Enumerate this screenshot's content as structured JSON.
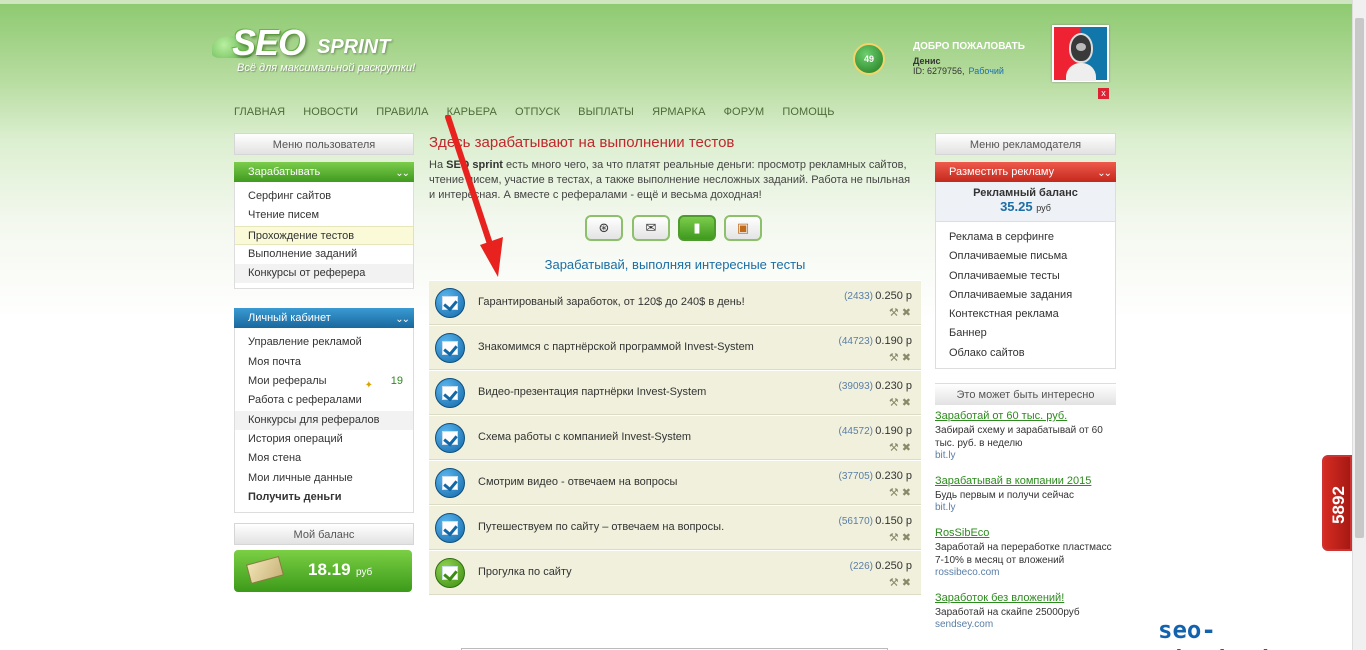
{
  "header": {
    "logo_main": "SEO",
    "logo_sub": "SPRINT",
    "tagline": "Всё для максимальной раскрутки!",
    "level": "49",
    "welcome": "ДОБРО ПОЖАЛОВАТЬ",
    "user_name": "Денис",
    "user_id": "ID: 6279756,",
    "user_status": "Рабочий",
    "close": "x"
  },
  "nav": [
    "ГЛАВНАЯ",
    "НОВОСТИ",
    "ПРАВИЛА",
    "КАРЬЕРА",
    "ОТПУСК",
    "ВЫПЛАТЫ",
    "ЯРМАРКА",
    "ФОРУМ",
    "ПОМОЩЬ"
  ],
  "left": {
    "user_menu_header": "Меню пользователя",
    "earn_tab": "Зарабатывать",
    "earn_items": [
      "Серфинг сайтов",
      "Чтение писем",
      "Прохождение тестов",
      "Выполнение заданий",
      "Конкурсы от реферера"
    ],
    "cabinet_tab": "Личный кабинет",
    "cabinet_items": [
      "Управление рекламой",
      "Моя почта",
      "Мои рефералы",
      "Работа с рефералами",
      "Конкурсы для рефералов",
      "История операций",
      "Моя стена",
      "Мои личные данные",
      "Получить деньги"
    ],
    "referrals_count": "19",
    "balance_header": "Мой баланс",
    "balance_value": "18.19",
    "balance_currency": "руб"
  },
  "center": {
    "title": "Здесь зарабатывают на выполнении тестов",
    "intro_prefix": "На",
    "intro_brand": "SEO sprint",
    "intro_text": "есть много чего, за что платят реальные деньги: просмотр рекламных сайтов, чтение писем, участие в тестах, а также выполнение несложных заданий. Работа не пыльная и интересная. А вместе с рефералами - ещё и весьма доходная!",
    "subtitle": "Зарабатывай, выполняя интересные тесты",
    "tests": [
      {
        "title": "Гарантированый заработок, от 120$ до 240$ в день!",
        "count": "(2433)",
        "price": "0.250 р"
      },
      {
        "title": "Знакомимся с партнёрской программой Invest-System",
        "count": "(44723)",
        "price": "0.190 р"
      },
      {
        "title": "Видео-презентация партнёрки Invest-System",
        "count": "(39093)",
        "price": "0.230 р"
      },
      {
        "title": "Схема работы с компанией Invest-System",
        "count": "(44572)",
        "price": "0.190 р"
      },
      {
        "title": "Смотрим видео - отвечаем на вопросы",
        "count": "(37705)",
        "price": "0.230 р"
      },
      {
        "title": "Путешествуем по сайту – отвечаем на вопросы.",
        "count": "(56170)",
        "price": "0.150 р"
      },
      {
        "title": "Прогулка по сайту",
        "count": "(226)",
        "price": "0.250 р"
      }
    ]
  },
  "right": {
    "adv_menu_header": "Меню рекламодателя",
    "place_ad_tab": "Разместить рекламу",
    "ad_balance_label": "Рекламный баланс",
    "ad_balance_value": "35.25",
    "ad_balance_currency": "руб",
    "adv_items": [
      "Реклама в серфинге",
      "Оплачиваемые письма",
      "Оплачиваемые тесты",
      "Оплачиваемые задания",
      "Контекстная реклама",
      "Баннер",
      "Облако сайтов"
    ],
    "interest_header": "Это может быть интересно",
    "ads": [
      {
        "title": "Заработай от 60 тыс. руб.",
        "desc": "Забирай схему и зарабатывай от 60 тыс. руб. в неделю",
        "url": "bit.ly"
      },
      {
        "title": "Зарабатывай в компании 2015",
        "desc": "Будь первым и получи сейчас",
        "url": "bit.ly"
      },
      {
        "title": "RosSibEco",
        "desc": "Заработай на переработке пластмасс 7-10% в месяц от вложений",
        "url": "rossibeco.com"
      },
      {
        "title": "Заработок без вложений!",
        "desc": "Заработай на скайпе 25000руб",
        "url": "sendsey.com"
      }
    ]
  },
  "side_badge": "5892",
  "watermark": "seo-start.at.ua",
  "colors": {
    "accent_green": "#3f9a1e",
    "accent_red": "#c1272d",
    "link_blue": "#1b6ea6"
  }
}
